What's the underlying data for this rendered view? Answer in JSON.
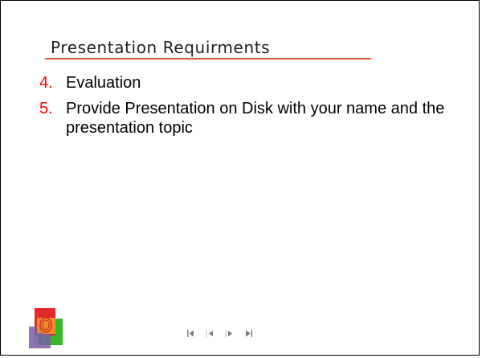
{
  "slide": {
    "title": "Presentation Requirments",
    "items": [
      {
        "number": "4.",
        "text": "Evaluation"
      },
      {
        "number": "5.",
        "text": "Provide Presentation on Disk with your name and the presentation topic"
      }
    ]
  },
  "navigation": {
    "first_icon": "first-slide-icon",
    "previous_icon": "previous-slide-icon",
    "next_icon": "next-slide-icon",
    "last_icon": "last-slide-icon"
  },
  "colors": {
    "title_rule": "#e05a33",
    "bullet_numbers": "#ff0000",
    "border": "#000000"
  }
}
